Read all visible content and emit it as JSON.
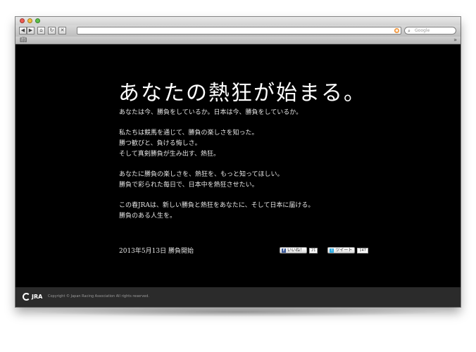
{
  "browser": {
    "search_placeholder": "Google",
    "icons": {
      "back": "triangle-left-icon",
      "forward": "triangle-right-icon",
      "home": "home-icon",
      "reload": "reload-icon",
      "stop": "stop-icon",
      "rss": "rss-icon",
      "search": "magnifier-icon",
      "bookmarks": "book-icon",
      "more": "double-chevron-icon"
    }
  },
  "page": {
    "headline": "あなたの熱狂が始まる。",
    "paragraphs": [
      [
        "あなたは今、勝負をしているか。日本は今、勝負をしているか。"
      ],
      [
        "私たちは競馬を通じて、勝負の楽しさを知った。",
        "勝つ歓びと、負ける悔しさ。",
        "そして真剣勝負が生み出す、熱狂。"
      ],
      [
        "あなたに勝負の楽しさを、熱狂を、もっと知ってほしい。",
        "勝負で彩られた毎日で、日本中を熱狂させたい。"
      ],
      [
        "この春JRAは、新しい勝負と熱狂をあなたに、そして日本に届ける。",
        "勝負のある人生を。"
      ]
    ],
    "date_line": "2013年5月13日 勝負開始",
    "social": {
      "like_label": "いいね！",
      "like_count": "21",
      "tweet_label": "ツイート",
      "tweet_count": "147"
    }
  },
  "footer": {
    "logo_text": "JRA",
    "copyright": "Copyright © Japan Racing Association All rights reserved."
  },
  "colors": {
    "page_background": "#000000",
    "text": "#ffffff",
    "footer_background": "#2b2b2b",
    "facebook": "#3b5998",
    "twitter": "#2aa9e0"
  }
}
